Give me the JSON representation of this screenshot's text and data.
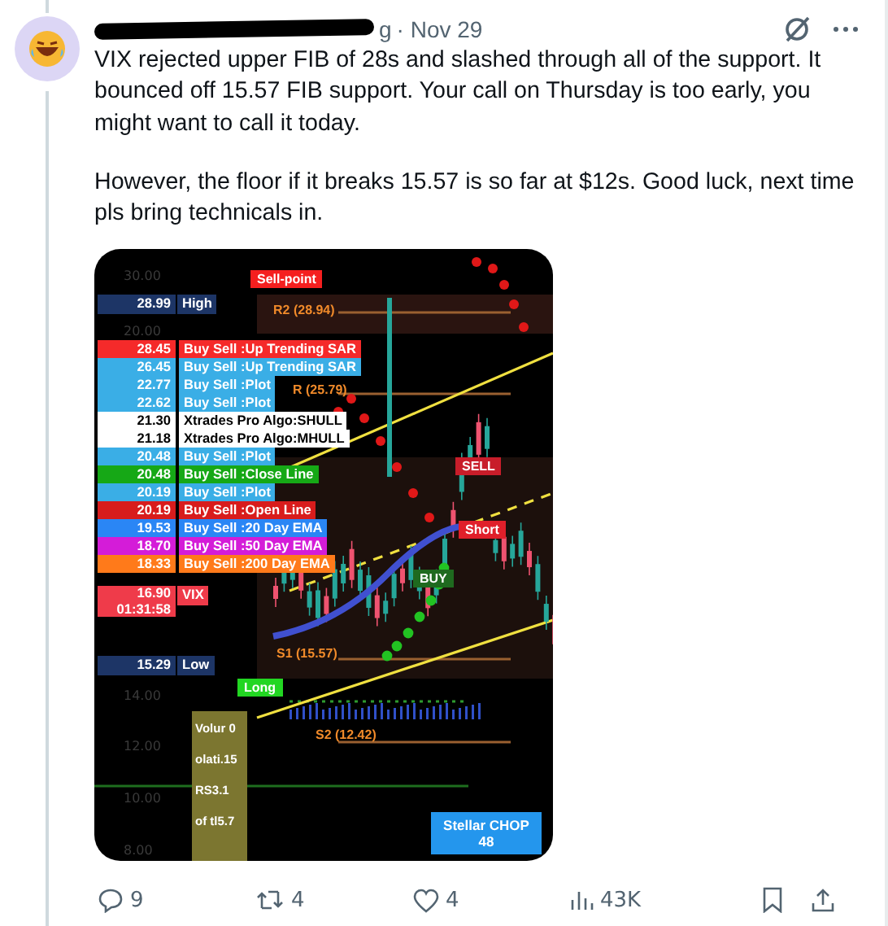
{
  "post": {
    "name_fragment": "g",
    "time": "· Nov 29",
    "paragraphs": [
      "VIX rejected upper FIB of 28s and slashed through all of the support. It bounced off 15.57 FIB support. Your call on Thursday is too early, you might want to call it today.",
      "However, the floor if it breaks 15.57 is so far at $12s. Good luck, next time pls bring technicals in."
    ]
  },
  "chart": {
    "axis_labels": [
      "30.00",
      "20.00",
      "14.00",
      "12.00",
      "10.00",
      "8.00"
    ],
    "high": {
      "price": "28.99",
      "label": "High"
    },
    "levels": [
      {
        "price": "28.45",
        "label": "Buy Sell :Up Trending SAR",
        "color": "#f52a2a"
      },
      {
        "price": "26.45",
        "label": "Buy Sell :Up Trending SAR",
        "color": "#3aaee6"
      },
      {
        "price": "22.77",
        "label": "Buy Sell :Plot",
        "color": "#3aaee6"
      },
      {
        "price": "22.62",
        "label": "Buy Sell :Plot",
        "color": "#3aaee6"
      },
      {
        "price": "21.30",
        "label": "Xtrades Pro Algo:SHULL",
        "color": "#ffffff"
      },
      {
        "price": "21.18",
        "label": "Xtrades Pro Algo:MHULL",
        "color": "#ffffff"
      },
      {
        "price": "20.48",
        "label": "Buy Sell :Plot",
        "color": "#3aaee6"
      },
      {
        "price": "20.48",
        "label": "Buy Sell :Close Line",
        "color": "#16a816"
      },
      {
        "price": "20.19",
        "label": "Buy Sell :Plot",
        "color": "#3aaee6"
      },
      {
        "price": "20.19",
        "label": "Buy Sell :Open Line",
        "color": "#d81c1c"
      },
      {
        "price": "19.53",
        "label": "Buy Sell :20 Day EMA",
        "color": "#2a86f5"
      },
      {
        "price": "18.70",
        "label": "Buy Sell :50 Day EMA",
        "color": "#d41cd8"
      },
      {
        "price": "18.33",
        "label": "Buy Sell :200 Day EMA",
        "color": "#ff7a1a"
      }
    ],
    "current": {
      "price": "16.90",
      "countdown": "01:31:58",
      "label": "VIX"
    },
    "low": {
      "price": "15.29",
      "label": "Low"
    },
    "markers": [
      {
        "text": "Sell-point",
        "kind": "box",
        "color": "#f51f1f"
      },
      {
        "text": "R2 (28.94)",
        "kind": "text",
        "color": "#f08a2a"
      },
      {
        "text": "R (25.79)",
        "kind": "text",
        "color": "#f08a2a"
      },
      {
        "text": "SELL",
        "kind": "box",
        "color": "#c81d2a"
      },
      {
        "text": "Short",
        "kind": "box",
        "color": "#e01f2a"
      },
      {
        "text": "BUY",
        "kind": "box",
        "color": "#1f6a1f"
      },
      {
        "text": "S1 (15.57)",
        "kind": "text",
        "color": "#f08a2a"
      },
      {
        "text": "Long",
        "kind": "box",
        "color": "#22d622"
      },
      {
        "text": "S2 (12.42)",
        "kind": "text",
        "color": "#f08a2a"
      }
    ],
    "info_box": [
      "Volur 0",
      "olati.15",
      "RS3.1",
      "of tl5.7"
    ],
    "badge": {
      "title": "Stellar CHOP",
      "value": "48"
    }
  },
  "actions": {
    "replies": "9",
    "reposts": "4",
    "likes": "4",
    "views": "43K"
  }
}
